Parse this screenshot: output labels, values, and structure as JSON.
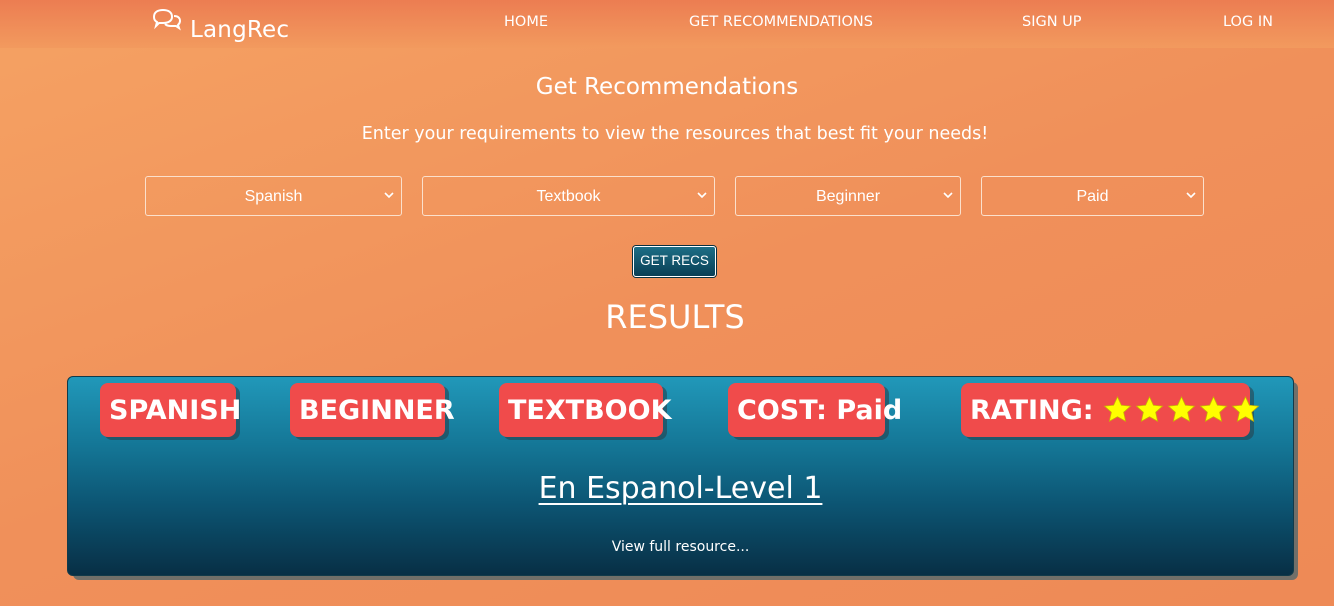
{
  "brand": {
    "name": "LangRec",
    "icon": "chat-bubbles-icon"
  },
  "nav": {
    "home": "HOME",
    "get_recommendations": "GET RECOMMENDATIONS",
    "sign_up": "SIGN UP",
    "log_in": "LOG IN"
  },
  "main": {
    "title": "Get Recommendations",
    "subtitle": "Enter your requirements to view the resources that best fit your needs!",
    "filters": {
      "language": "Spanish",
      "resource_type": "Textbook",
      "level": "Beginner",
      "cost": "Paid"
    },
    "submit_label": "GET RECS",
    "results_heading": "RESULTS"
  },
  "result": {
    "language_tag": "SPANISH",
    "level_tag": "BEGINNER",
    "type_tag": "TEXTBOOK",
    "cost_tag": "COST: Paid",
    "rating_label": "RATING:",
    "rating": 5,
    "rating_max": 5,
    "title": "En Espanol-Level 1",
    "view_link": "View full resource..."
  },
  "colors": {
    "background": "#f29a5e",
    "tag": "#f04b4b",
    "card_top": "#2198b9",
    "card_bottom": "#082f45",
    "star": "#ffff00",
    "button": "#0a3f55"
  }
}
